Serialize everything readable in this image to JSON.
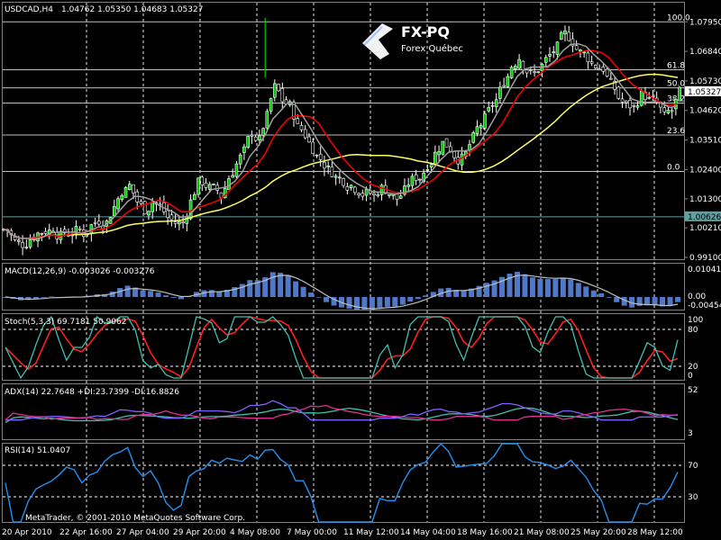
{
  "main": {
    "title": "USDCAD,H4",
    "ohlc": "1.04762 1.05350 1.04683 1.05327",
    "yticks": [
      "1.07950",
      "1.06840",
      "1.05730",
      "1.04620",
      "1.03510",
      "1.02400",
      "1.01300",
      "1.00210",
      "0.99100"
    ],
    "price_badge": "1.05327",
    "hline_badge": "1.00626",
    "fib": [
      "100.0",
      "61.8",
      "50.0",
      "38.2",
      "23.6",
      "0.0"
    ]
  },
  "logo": {
    "name": "FX-PQ",
    "sub": "Forex Québec"
  },
  "panels": {
    "macd": {
      "title": "MACD(12,26,9) -0.003026 -0.003276",
      "ticks": [
        "0.010411",
        "0.00",
        "-0.00454"
      ]
    },
    "stoch": {
      "title": "Stoch(5,3,3) 69.7181 50.9062",
      "ticks": [
        "100",
        "80",
        "20",
        "0"
      ]
    },
    "adx": {
      "title": "ADX(14) 22.7648 +DI:23.7399 -DI:16.8826",
      "ticks": [
        "52",
        "3"
      ]
    },
    "rsi": {
      "title": "RSI(14) 51.0407",
      "ticks": [
        "70",
        "30"
      ]
    }
  },
  "xlabels": [
    "20 Apr 2010",
    "22 Apr 16:00",
    "27 Apr 04:00",
    "29 Apr 20:00",
    "4 May 08:00",
    "7 May 00:00",
    "11 May 12:00",
    "14 May 04:00",
    "18 May 16:00",
    "21 May 08:00",
    "25 May 20:00",
    "28 May 12:00"
  ],
  "copyright": "MetaTrader, © 2001-2010 MetaQuotes Software Corp.",
  "colors": {
    "bull": "#00c800",
    "bear": "#000000",
    "ma_fast": "#a0a0a0",
    "ma_mid": "#ff0000",
    "ma_slow": "#ffff64",
    "macd_hist": "#5078c8",
    "stoch_main": "#40c0b0",
    "stoch_signal": "#ff2020",
    "adx": "#40c0b0",
    "di_plus": "#8060ff",
    "di_minus": "#e03090",
    "rsi": "#2090f0"
  },
  "chart_data": {
    "type": "candlestick",
    "symbol": "USDCAD",
    "timeframe": "H4",
    "ylim": [
      0.991,
      1.085
    ],
    "close_series": [
      1.0015,
      0.997,
      0.996,
      0.998,
      1.0,
      1.001,
      1.002,
      0.999,
      1.0,
      1.001,
      1.0,
      1.003,
      1.005,
      1.004,
      1.01,
      1.016,
      1.018,
      1.012,
      1.009,
      1.012,
      1.01,
      1.006,
      1.004,
      1.004,
      1.012,
      1.019,
      1.018,
      1.017,
      1.014,
      1.021,
      1.026,
      1.031,
      1.038,
      1.035,
      1.044,
      1.055,
      1.05,
      1.048,
      1.04,
      1.037,
      1.032,
      1.028,
      1.024,
      1.021,
      1.02,
      1.018,
      1.016,
      1.015,
      1.014,
      1.017,
      1.015,
      1.013,
      1.016,
      1.02,
      1.021,
      1.026,
      1.03,
      1.034,
      1.032,
      1.028,
      1.03,
      1.036,
      1.041,
      1.046,
      1.05,
      1.057,
      1.063,
      1.066,
      1.061,
      1.06,
      1.063,
      1.067,
      1.07,
      1.075,
      1.072,
      1.068,
      1.066,
      1.063,
      1.062,
      1.056,
      1.051,
      1.048,
      1.047,
      1.052,
      1.05,
      1.049,
      1.044,
      1.046,
      1.053
    ],
    "horizontal_level": 1.00626,
    "last_price": 1.05327,
    "fibonacci": [
      {
        "level": "100.0",
        "price": 1.0795
      },
      {
        "level": "61.8",
        "price": 1.0615
      },
      {
        "level": "50.0",
        "price": 1.0547
      },
      {
        "level": "38.2",
        "price": 1.049
      },
      {
        "level": "23.6",
        "price": 1.037
      },
      {
        "level": "0.0",
        "price": 1.0233
      }
    ],
    "indicators": {
      "macd": {
        "params": "12,26,9",
        "main": -0.003026,
        "signal": -0.003276,
        "ylim": [
          -0.00454,
          0.010411
        ]
      },
      "stochastic": {
        "params": "5,3,3",
        "main": 69.7181,
        "signal": 50.9062,
        "levels": [
          80,
          20
        ]
      },
      "adx": {
        "period": 14,
        "adx": 22.7648,
        "di_plus": 23.7399,
        "di_minus": 16.8826
      },
      "rsi": {
        "period": 14,
        "value": 51.0407,
        "levels": [
          70,
          30
        ]
      }
    }
  }
}
